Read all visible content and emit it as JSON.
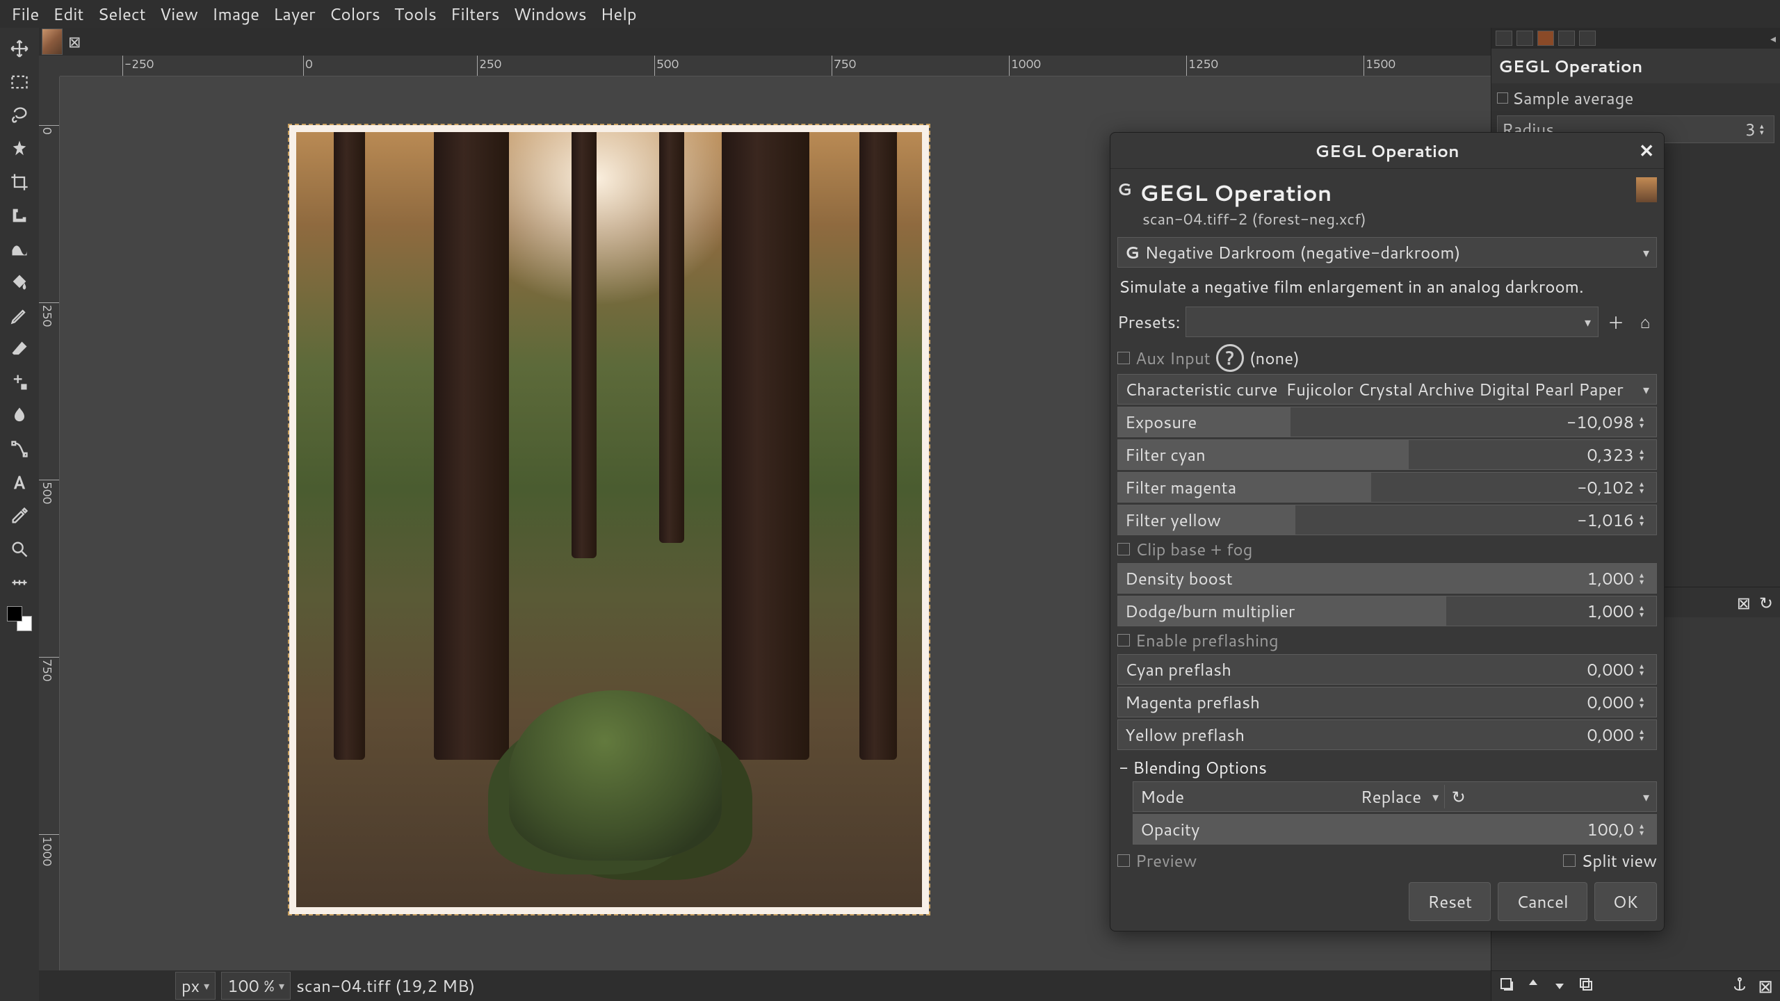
{
  "menu": [
    "File",
    "Edit",
    "Select",
    "View",
    "Image",
    "Layer",
    "Colors",
    "Tools",
    "Filters",
    "Windows",
    "Help"
  ],
  "ruler_h": [
    {
      "pos": 90,
      "label": "-250"
    },
    {
      "pos": 350,
      "label": "0"
    },
    {
      "pos": 600,
      "label": "250"
    },
    {
      "pos": 855,
      "label": "500"
    },
    {
      "pos": 1110,
      "label": "750"
    },
    {
      "pos": 1365,
      "label": "1000"
    },
    {
      "pos": 1620,
      "label": "1250"
    },
    {
      "pos": 1875,
      "label": "1500"
    }
  ],
  "ruler_v": [
    {
      "pos": 70,
      "label": "0"
    },
    {
      "pos": 325,
      "label": "250"
    },
    {
      "pos": 580,
      "label": "500"
    },
    {
      "pos": 835,
      "label": "750"
    },
    {
      "pos": 1090,
      "label": "1000"
    }
  ],
  "status": {
    "unit": "px",
    "zoom": "100 %",
    "file": "scan-04.tiff (19,2 MB)"
  },
  "tool_options": {
    "title": "GEGL Operation",
    "sample_average": "Sample average",
    "radius_label": "Radius",
    "radius_value": "3"
  },
  "dialog": {
    "title": "GEGL Operation",
    "heading": "GEGL Operation",
    "sub": "scan-04.tiff-2 (forest-neg.xcf)",
    "op_select": "Negative Darkroom (negative-darkroom)",
    "description": "Simulate a negative film enlargement in an analog darkroom.",
    "presets_label": "Presets:",
    "aux_input": "Aux Input",
    "aux_value": "(none)",
    "curve_label": "Characteristic curve",
    "curve_value": "Fujicolor Crystal Archive Digital Pearl Paper",
    "params": {
      "exposure": {
        "label": "Exposure",
        "value": "-10,098",
        "fill": 32
      },
      "fcyan": {
        "label": "Filter cyan",
        "value": "0,323",
        "fill": 54
      },
      "fmag": {
        "label": "Filter magenta",
        "value": "-0,102",
        "fill": 47
      },
      "fyel": {
        "label": "Filter yellow",
        "value": "-1,016",
        "fill": 33
      },
      "clip": "Clip base + fog",
      "dboost": {
        "label": "Density boost",
        "value": "1,000",
        "fill": 100
      },
      "dodge": {
        "label": "Dodge/burn multiplier",
        "value": "1,000",
        "fill": 61
      },
      "preflash": "Enable preflashing",
      "cpre": {
        "label": "Cyan preflash",
        "value": "0,000",
        "fill": 0
      },
      "mpre": {
        "label": "Magenta preflash",
        "value": "0,000",
        "fill": 0
      },
      "ypre": {
        "label": "Yellow preflash",
        "value": "0,000",
        "fill": 0
      }
    },
    "blend": {
      "title": "Blending Options",
      "mode_label": "Mode",
      "mode_value": "Replace",
      "opacity_label": "Opacity",
      "opacity_value": "100,0"
    },
    "preview": "Preview",
    "split_view": "Split view",
    "reset": "Reset",
    "cancel": "Cancel",
    "ok": "OK"
  }
}
